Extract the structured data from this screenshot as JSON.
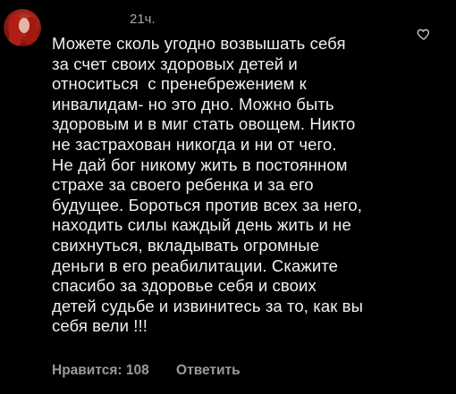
{
  "comment": {
    "time": "21ч.",
    "text": "Можете сколь угодно возвышать себя\nза счет своих здоровых детей и\nотноситься  с пренебрежением к\nинвалидам- но это дно. Можно быть\nздоровым и в миг стать овощем. Никто\nне застрахован никогда и ни от чего.\nНе дай бог никому жить в постоянном\nстрахе за своего ребенка и за его\nбудущее. Бороться против всех за него,\nнаходить силы каждый день жить и не\nсвихнуться, вкладывать огромные\nденьги в его реабилитации. Скажите\nспасибо за здоровье себя и своих\nдетей судьбе и извинитесь за то, как вы\nсебя вели !!!",
    "likes_label": "Нравится: 108",
    "reply_label": "Ответить",
    "like_icon": "heart-outline-icon",
    "avatar_color": "#b01e14"
  }
}
